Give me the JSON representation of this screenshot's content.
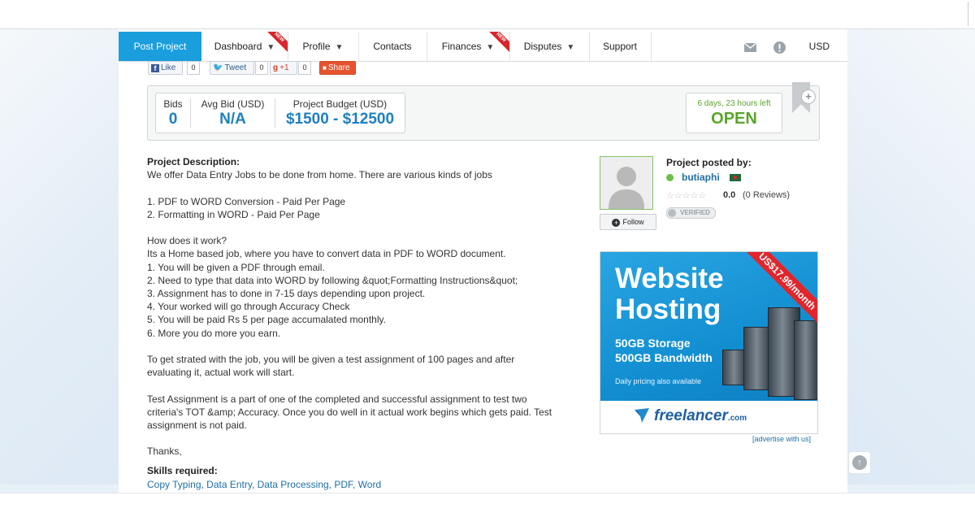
{
  "nav": {
    "post_project": "Post Project",
    "items": [
      {
        "label": "Dashboard",
        "caret": "▼",
        "badge": "NEW"
      },
      {
        "label": "Profile",
        "caret": "▼"
      },
      {
        "label": "Contacts"
      },
      {
        "label": "Finances",
        "caret": "▼",
        "badge": "NEW"
      },
      {
        "label": "Disputes",
        "caret": "▼"
      },
      {
        "label": "Support"
      }
    ],
    "mail_icon": "mail-icon",
    "alert_icon": "alert-icon",
    "currency": "USD"
  },
  "social": {
    "like_label": "Like",
    "like_count": "0",
    "tweet_label": "Tweet",
    "tweet_count": "0",
    "gplus_label": "+1",
    "gplus_count": "0",
    "share_label": "Share"
  },
  "stats": {
    "bids_label": "Bids",
    "bids_value": "0",
    "avg_bid_label": "Avg Bid (USD)",
    "avg_bid_value": "N/A",
    "budget_label": "Project Budget (USD)",
    "budget_value": "$1500 - $12500",
    "time_left": "6 days, 23 hours left",
    "status": "OPEN"
  },
  "description": {
    "title": "Project Description:",
    "lines": [
      "We offer Data Entry Jobs to be done from home. There are various kinds of jobs",
      "",
      "1. PDF to WORD Conversion - Paid Per Page",
      "2. Formatting in WORD - Paid Per Page",
      "",
      "How does it work?",
      "Its a Home based job, where you have to convert data in PDF to WORD document.",
      "1. You will be given a PDF through email.",
      "2. Need to type that data into WORD by following &quot;Formatting Instructions&quot;",
      "3. Assignment has to done in 7-15 days depending upon project.",
      "4. Your worked will go through Accuracy Check",
      "5. You will be paid Rs 5 per page accumalated monthly.",
      "6. More you do more you earn.",
      "",
      "To get strated with the job, you will be given a test assignment of 100 pages and after",
      "evaluating it, actual work will start.",
      "",
      "Test Assignment is a part of one of the completed and successful assignment to test two",
      "criteria's TOT &amp; Accuracy. Once you do well in it actual work begins which gets paid. Test",
      "assignment is not paid.",
      "",
      "Thanks,"
    ],
    "skills_title": "Skills required:",
    "skills": "Copy Typing, Data Entry, Data Processing, PDF, Word"
  },
  "poster": {
    "title": "Project posted by:",
    "username": "butiaphi",
    "stars": "☆☆☆☆☆",
    "rating": "0.0",
    "reviews": "(0 Reviews)",
    "verified": "VERIFIED",
    "follow": "Follow"
  },
  "ad": {
    "title_line1": "Website",
    "title_line2": "Hosting",
    "price": "US$17.99/month",
    "storage": "50GB Storage",
    "bandwidth": "500GB Bandwidth",
    "small": "Daily pricing also available",
    "brand": "freelancer",
    "brand_suffix": ".com",
    "advertise": "[advertise with us]"
  }
}
